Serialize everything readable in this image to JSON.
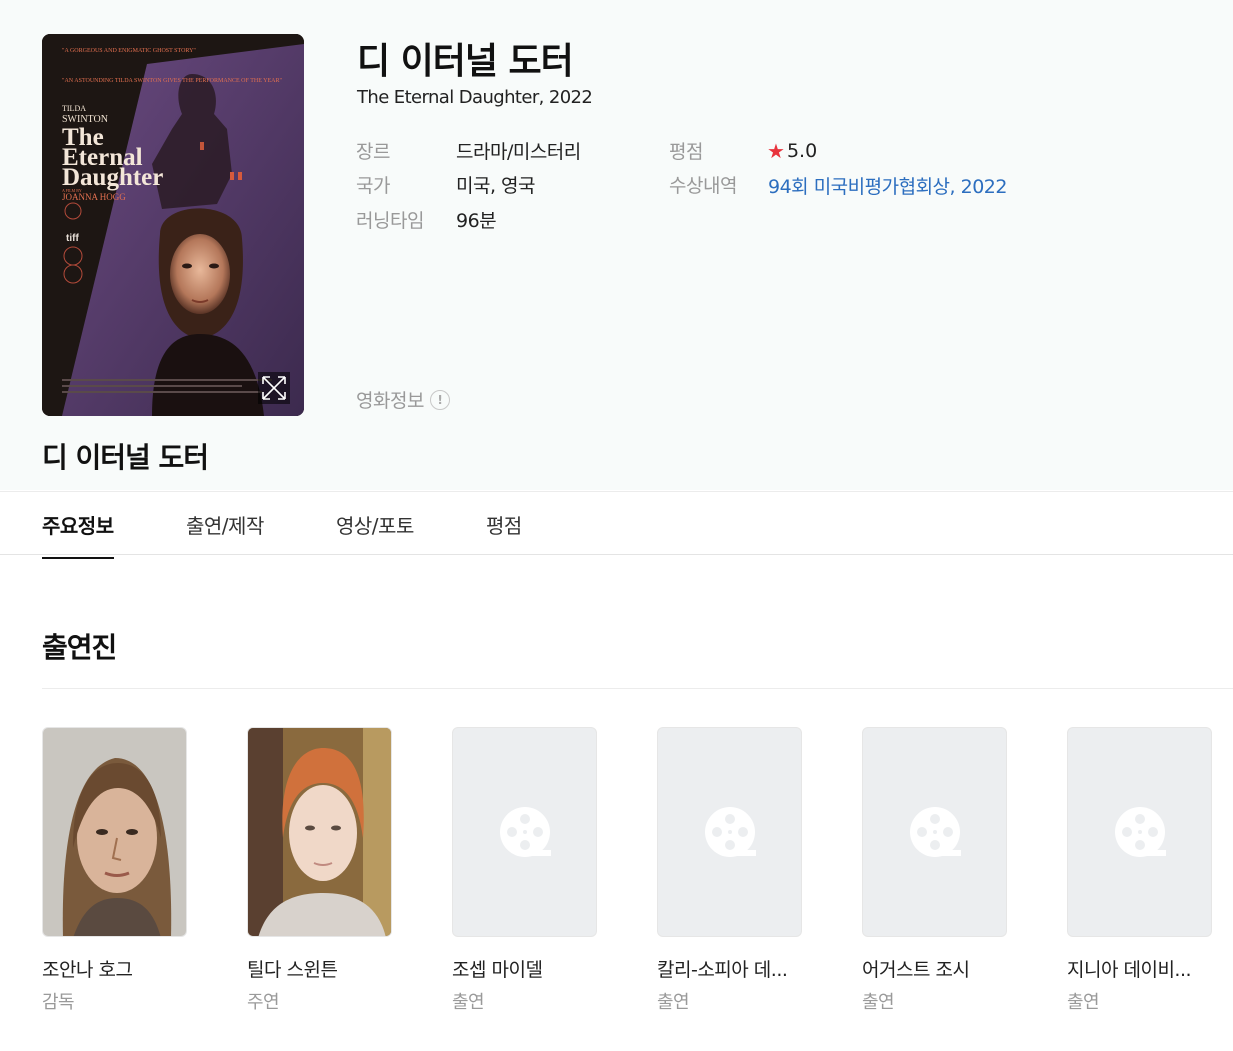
{
  "movie": {
    "title_ko": "디 이터널 도터",
    "title_en": "The Eternal Daughter, 2022",
    "info": {
      "genre_label": "장르",
      "genre_value": "드라마/미스터리",
      "country_label": "국가",
      "country_value": "미국, 영국",
      "runtime_label": "러닝타임",
      "runtime_value": "96분",
      "rating_label": "평점",
      "rating_value": "5.0",
      "award_label": "수상내역",
      "award_value": "94회 미국비평가협회상, 2022"
    },
    "movie_info_label": "영화정보"
  },
  "poster": {
    "quote1": "\"A GORGEOUS AND ENIGMATIC GHOST STORY\"",
    "quote2": "\"AN ASTOUNDING TILDA SWINTON GIVES THE PERFORMANCE OF THE YEAR\"",
    "actor_line1": "TILDA",
    "actor_line2": "SWINTON",
    "title_line1": "The",
    "title_line2": "Eternal",
    "title_line3": "Daughter",
    "film_by": "A FILM BY",
    "director": "JOANNA HOGG",
    "festival": "tiff"
  },
  "tabs": [
    {
      "label": "주요정보"
    },
    {
      "label": "출연/제작"
    },
    {
      "label": "영상/포토"
    },
    {
      "label": "평점"
    }
  ],
  "cast_section": {
    "title": "출연진",
    "members": [
      {
        "name": "조안나 호그",
        "role": "감독"
      },
      {
        "name": "틸다 스윈튼",
        "role": "주연"
      },
      {
        "name": "조셉 마이델",
        "role": "출연"
      },
      {
        "name": "칼리-소피아 데...",
        "role": "출연"
      },
      {
        "name": "어거스트 조시",
        "role": "출연"
      },
      {
        "name": "지니아 데이비...",
        "role": "출연"
      }
    ]
  },
  "colors": {
    "accent_link": "#2c6ebf",
    "star": "#e8343d",
    "poster_purple": "#5a3f6e"
  },
  "icons": {
    "expand": "expand-icon",
    "info": "info-icon",
    "placeholder": "film-reel-icon"
  }
}
